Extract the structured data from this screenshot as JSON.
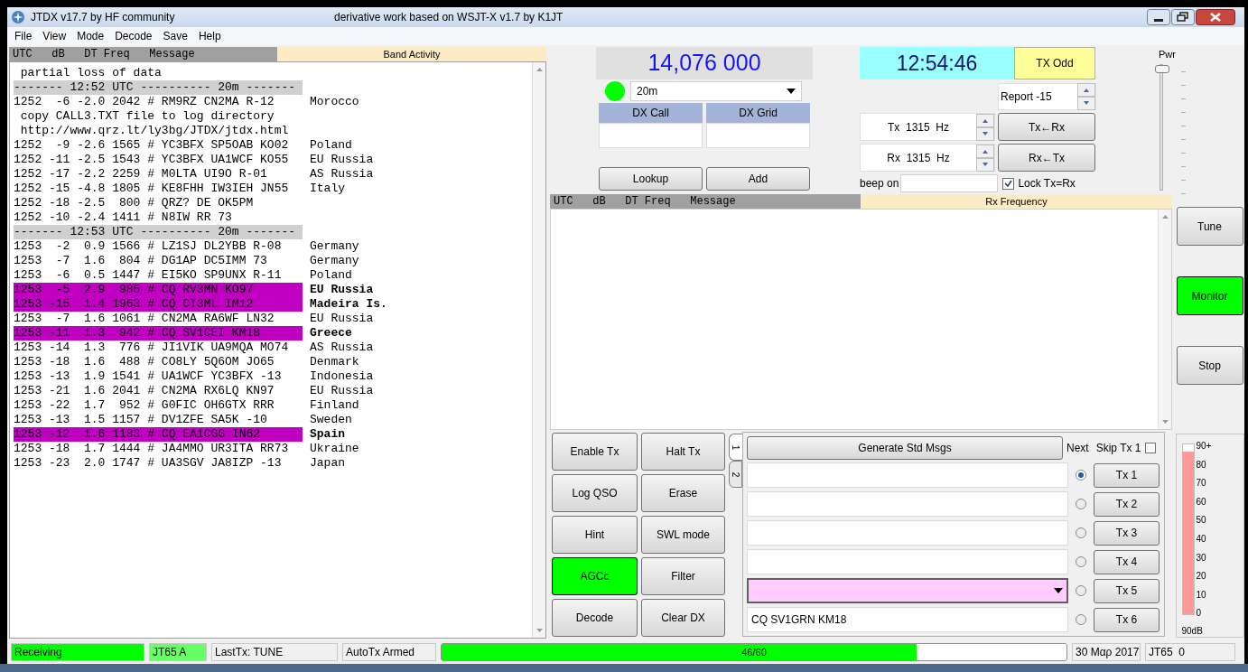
{
  "window": {
    "title": "JTDX v17.7  by HF community",
    "subtitle": "derivative work based on WSJT-X v1.7 by K1JT"
  },
  "menu": [
    "File",
    "View",
    "Mode",
    "Decode",
    "Save",
    "Help"
  ],
  "band_activity": {
    "columns": "UTC   dB   DT Freq   Message",
    "title": "Band Activity",
    "lines": [
      {
        "kind": "text",
        "text": " partial loss of data"
      },
      {
        "kind": "separator",
        "text": "------- 12:52 UTC ---------- 20m -------"
      },
      {
        "kind": "decode",
        "text": "1252  -6 -2.0 2042 # RM9RZ CN2MA R-12",
        "country": "Morocco",
        "highlighted": false
      },
      {
        "kind": "text",
        "text": " copy CALL3.TXT file to log directory"
      },
      {
        "kind": "text",
        "text": " http://www.qrz.lt/ly3bg/JTDX/jtdx.html"
      },
      {
        "kind": "decode",
        "text": "1252  -9 -2.6 1565 # YC3BFX SP5OAB KO02",
        "country": "Poland",
        "highlighted": false
      },
      {
        "kind": "decode",
        "text": "1252 -11 -2.5 1543 # YC3BFX UA1WCF KO55",
        "country": "EU Russia",
        "highlighted": false
      },
      {
        "kind": "decode",
        "text": "1252 -17 -2.2 2259 # M0LTA UI9O R-01",
        "country": "AS Russia",
        "highlighted": false
      },
      {
        "kind": "decode",
        "text": "1252 -15 -4.8 1805 # KE8FHH IW3IEH JN55",
        "country": "Italy",
        "highlighted": false
      },
      {
        "kind": "decode",
        "text": "1252 -18 -2.5  800 # QRZ? DE OK5PM",
        "highlighted": false
      },
      {
        "kind": "decode",
        "text": "1252 -10 -2.4 1411 # N8IW RR 73",
        "highlighted": false
      },
      {
        "kind": "separator",
        "text": "------- 12:53 UTC ---------- 20m -------"
      },
      {
        "kind": "decode",
        "text": "1253  -2  0.9 1566 # LZ1SJ DL2YBB R-08",
        "country": "Germany",
        "highlighted": false
      },
      {
        "kind": "decode",
        "text": "1253  -7  1.6  804 # DG1AP DC5IMM 73",
        "country": "Germany",
        "highlighted": false
      },
      {
        "kind": "decode",
        "text": "1253  -6  0.5 1447 # EI5KO SP9UNX R-11",
        "country": "Poland",
        "highlighted": false
      },
      {
        "kind": "decode",
        "text": "1253  -5  2.9  985 # CQ RV3MN KO97",
        "country": "EU Russia",
        "highlighted": true
      },
      {
        "kind": "decode",
        "text": "1253 -15  1.4 1963 # CQ CT3ML IM12",
        "country": "Madeira Is.",
        "highlighted": true
      },
      {
        "kind": "decode",
        "text": "1253  -7  1.6 1061 # CN2MA RA6WF LN32",
        "country": "EU Russia",
        "highlighted": false
      },
      {
        "kind": "decode",
        "text": "1253 -11  1.3  942 # CQ SV1CEI KM18",
        "country": "Greece",
        "highlighted": true
      },
      {
        "kind": "decode",
        "text": "1253 -14  1.3  776 # JI1VIK UA9MQA MO74",
        "country": "AS Russia",
        "highlighted": false
      },
      {
        "kind": "decode",
        "text": "1253 -18  1.6  488 # CO8LY 5Q6OM JO65",
        "country": "Denmark",
        "highlighted": false
      },
      {
        "kind": "decode",
        "text": "1253 -13  1.9 1541 # UA1WCF YC3BFX -13",
        "country": "Indonesia",
        "highlighted": false
      },
      {
        "kind": "decode",
        "text": "1253 -21  1.6 2041 # CN2MA RX6LQ KN97",
        "country": "EU Russia",
        "highlighted": false
      },
      {
        "kind": "decode",
        "text": "1253 -22  1.7  952 # G0FIC OH6GTX RRR",
        "country": "Finland",
        "highlighted": false
      },
      {
        "kind": "decode",
        "text": "1253 -13  1.5 1157 # DV1ZFE SA5K -10",
        "country": "Sweden",
        "highlighted": false
      },
      {
        "kind": "decode",
        "text": "1253 -12  1.6 1183 # CQ EA1CGG IN62",
        "country": "Spain",
        "highlighted": true
      },
      {
        "kind": "decode",
        "text": "1253 -18  1.7 1444 # JA4MMO UR3ITA RR73",
        "country": "Ukraine",
        "highlighted": false
      },
      {
        "kind": "decode",
        "text": "1253 -23  2.0 1747 # UA3SGV JA8IZP -13",
        "country": "Japan",
        "highlighted": false
      }
    ]
  },
  "frequency": "14,076 000",
  "rig_status": {
    "color": "#00ff00"
  },
  "band": "20m",
  "dx_call": {
    "label": "DX Call"
  },
  "dx_grid": {
    "label": "DX Grid"
  },
  "lookup_button": "Lookup",
  "add_button": "Add",
  "clock": "12:54:46",
  "tx_odd_button": "TX Odd",
  "report": "Report -15",
  "tx_freq": "Tx  1315  Hz",
  "rx_freq": "Rx  1315  Hz",
  "tx_from_rx_button": "Tx←Rx",
  "rx_from_tx_button": "Rx←Tx",
  "beep": {
    "label": "beep on"
  },
  "lock": {
    "label": "Lock Tx=Rx",
    "checked": true
  },
  "power": {
    "label": "Pwr",
    "level": 1
  },
  "rx_frequency": {
    "columns": "UTC   dB   DT Freq   Message",
    "title": "Rx Frequency"
  },
  "side_buttons": [
    {
      "label": "Tune",
      "active": false
    },
    {
      "label": "Monitor",
      "active": true
    },
    {
      "label": "Stop",
      "active": false
    }
  ],
  "control_buttons": [
    {
      "label": "Enable Tx",
      "active": false
    },
    {
      "label": "Halt Tx",
      "active": false
    },
    {
      "label": "Log QSO",
      "active": false
    },
    {
      "label": "Erase",
      "active": false
    },
    {
      "label": "Hint",
      "active": false
    },
    {
      "label": "SWL mode",
      "active": false
    },
    {
      "label": "AGCc",
      "active": true
    },
    {
      "label": "Filter",
      "active": false
    },
    {
      "label": "Decode",
      "active": false
    },
    {
      "label": "Clear DX",
      "active": false
    }
  ],
  "tabs": [
    {
      "label": "1",
      "selected": true
    },
    {
      "label": "2",
      "selected": false
    }
  ],
  "generate_button": "Generate Std Msgs",
  "next_label": "Next",
  "skip_tx1": {
    "label": "Skip Tx 1",
    "checked": false
  },
  "tx_messages": [
    {
      "kind": "text",
      "selected": true,
      "button": "Tx 1"
    },
    {
      "kind": "text",
      "selected": false,
      "button": "Tx 2"
    },
    {
      "kind": "text",
      "selected": false,
      "button": "Tx 3"
    },
    {
      "kind": "text",
      "selected": false,
      "button": "Tx 4"
    },
    {
      "kind": "combo",
      "selected": false,
      "button": "Tx 5"
    },
    {
      "kind": "text",
      "value": "CQ SV1GRN KM18",
      "selected": false,
      "button": "Tx 6"
    }
  ],
  "signal_meter": {
    "level": 0.96,
    "ticks": [
      "90+",
      "80",
      "70",
      "60",
      "50",
      "40",
      "30",
      "20",
      "10",
      "0"
    ],
    "reading": "90dB"
  },
  "status_bar": [
    {
      "kind": "label",
      "text": "Receiving",
      "color": "#00ff00"
    },
    {
      "kind": "label",
      "text": "JT65 A",
      "color": "#66ff66"
    },
    {
      "kind": "label",
      "text": "LastTx: TUNE"
    },
    {
      "kind": "label",
      "text": "AutoTx Armed"
    },
    {
      "kind": "progress",
      "text": "46/60",
      "level": 0.76
    },
    {
      "kind": "label",
      "text": "30 Μαρ 2017"
    },
    {
      "kind": "label",
      "text": "JT65  0"
    }
  ]
}
